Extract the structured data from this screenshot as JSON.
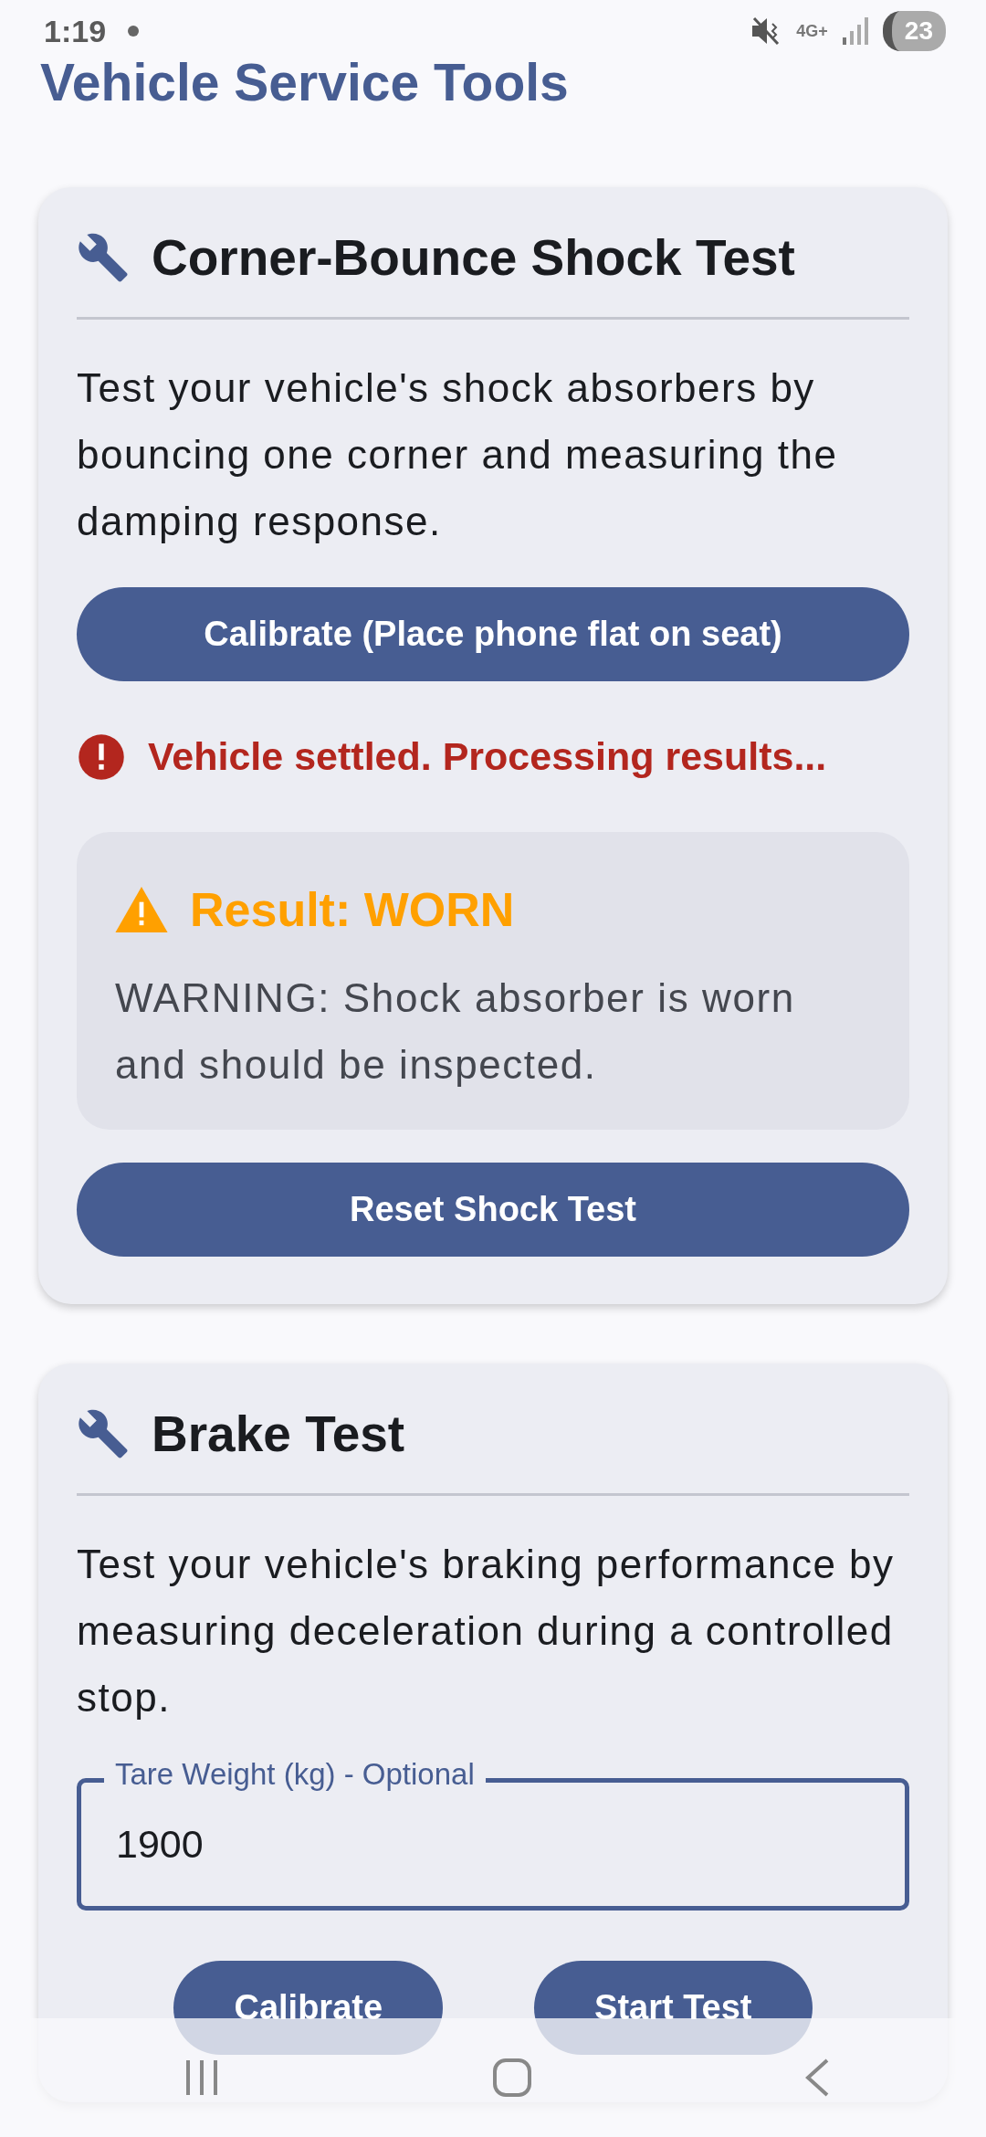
{
  "status_bar": {
    "time": "1:19",
    "network": "4G+",
    "battery": "23"
  },
  "app_title": "Vehicle Service Tools",
  "cards": [
    {
      "title": "Corner-Bounce Shock Test",
      "description": "Test your vehicle's shock absorbers by bouncing one corner and measuring the damping response.",
      "items": [
        {
          "kind": "button",
          "label": "Calibrate (Place phone flat on seat)"
        },
        {
          "kind": "alert",
          "text": "Vehicle settled. Processing results..."
        },
        {
          "kind": "result",
          "title": "Result: WORN",
          "message": "WARNING: Shock absorber is worn and should be inspected."
        },
        {
          "kind": "button",
          "label": "Reset Shock Test"
        }
      ]
    },
    {
      "title": "Brake Test",
      "description": "Test your vehicle's braking performance by measuring deceleration during a controlled stop.",
      "items": [
        {
          "kind": "field",
          "label": "Tare Weight (kg) - Optional",
          "value": "1900"
        },
        {
          "kind": "button_row",
          "buttons": [
            "Calibrate",
            "Start Test"
          ]
        }
      ]
    }
  ]
}
